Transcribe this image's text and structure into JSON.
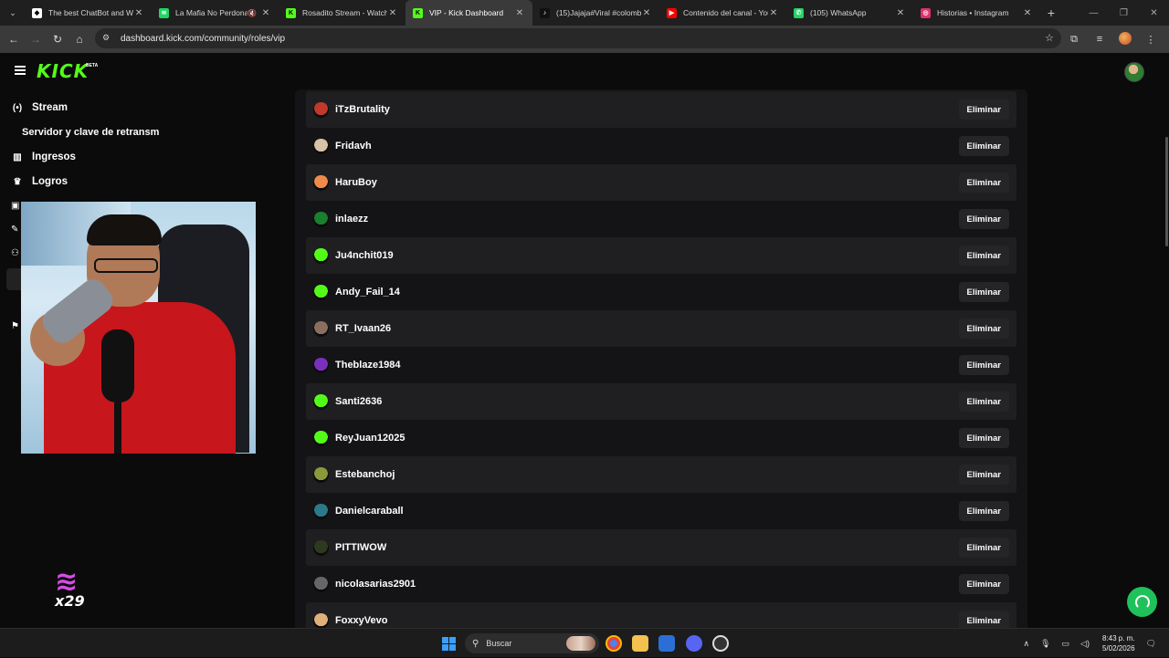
{
  "browser": {
    "tabs": [
      {
        "label": "The best ChatBot and Wi",
        "fav_color": "#ffffff",
        "fav_text": "◆",
        "active": false,
        "muted": false
      },
      {
        "label": "La Mafia No Perdona",
        "fav_color": "#1ed760",
        "fav_text": "≋",
        "active": false,
        "muted": true
      },
      {
        "label": "Rosadito Stream - Watch",
        "fav_color": "#53fc18",
        "fav_text": "K",
        "active": false,
        "muted": false
      },
      {
        "label": "VIP - Kick Dashboard",
        "fav_color": "#53fc18",
        "fav_text": "K",
        "active": true,
        "muted": false
      },
      {
        "label": "(15)Jajaja#Viral #colombi",
        "fav_color": "#111111",
        "fav_text": "♪",
        "active": false,
        "muted": false
      },
      {
        "label": "Contenido del canal - You",
        "fav_color": "#ff0000",
        "fav_text": "▶",
        "active": false,
        "muted": false
      },
      {
        "label": "(105) WhatsApp",
        "fav_color": "#25d366",
        "fav_text": "✆",
        "active": false,
        "muted": false
      },
      {
        "label": "Historias • Instagram",
        "fav_color": "#e1306c",
        "fav_text": "◎",
        "active": false,
        "muted": false
      }
    ],
    "url": "dashboard.kick.com/community/roles/vip"
  },
  "kick": {
    "logo": "KICK",
    "beta": "BETA"
  },
  "sidebar": {
    "items": [
      {
        "label": "Stream",
        "icon": "broadcast-icon",
        "glyph": "(•)"
      },
      {
        "label": "Ingresos",
        "icon": "bar-chart-icon",
        "glyph": "▥"
      },
      {
        "label": "Logros",
        "icon": "trophy-icon",
        "glyph": "♛"
      }
    ],
    "sub_item": "Servidor y clave de retransmisión"
  },
  "vip_list": [
    {
      "name": "iTzBrutality",
      "avatar": "#c0392b"
    },
    {
      "name": "Fridavh",
      "avatar": "#d9c2a7"
    },
    {
      "name": "HaruBoy",
      "avatar": "#f08a4b"
    },
    {
      "name": "inlaezz",
      "avatar": "#1a7f2e"
    },
    {
      "name": "Ju4nchit019",
      "avatar": "#53fc18"
    },
    {
      "name": "Andy_Fail_14",
      "avatar": "#53fc18"
    },
    {
      "name": "RT_Ivaan26",
      "avatar": "#8b6f5e"
    },
    {
      "name": "Theblaze1984",
      "avatar": "#7b2fbf"
    },
    {
      "name": "Santi2636",
      "avatar": "#53fc18"
    },
    {
      "name": "ReyJuan12025",
      "avatar": "#53fc18"
    },
    {
      "name": "Estebanchoj",
      "avatar": "#8a9a3a"
    },
    {
      "name": "Danielcaraball",
      "avatar": "#2b7a8c"
    },
    {
      "name": "PITTIWOW",
      "avatar": "#2d3a1f"
    },
    {
      "name": "nicolasarias2901",
      "avatar": "#666666"
    },
    {
      "name": "FoxxyVevo",
      "avatar": "#e0b07a"
    }
  ],
  "actions": {
    "remove_label": "Eliminar"
  },
  "overlay": {
    "brand_text": "x29"
  },
  "taskbar": {
    "search_placeholder": "Buscar",
    "time": "8:43 p. m.",
    "date": "5/02/2026"
  },
  "colors": {
    "accent": "#53fc18",
    "support": "#1fc25a"
  }
}
